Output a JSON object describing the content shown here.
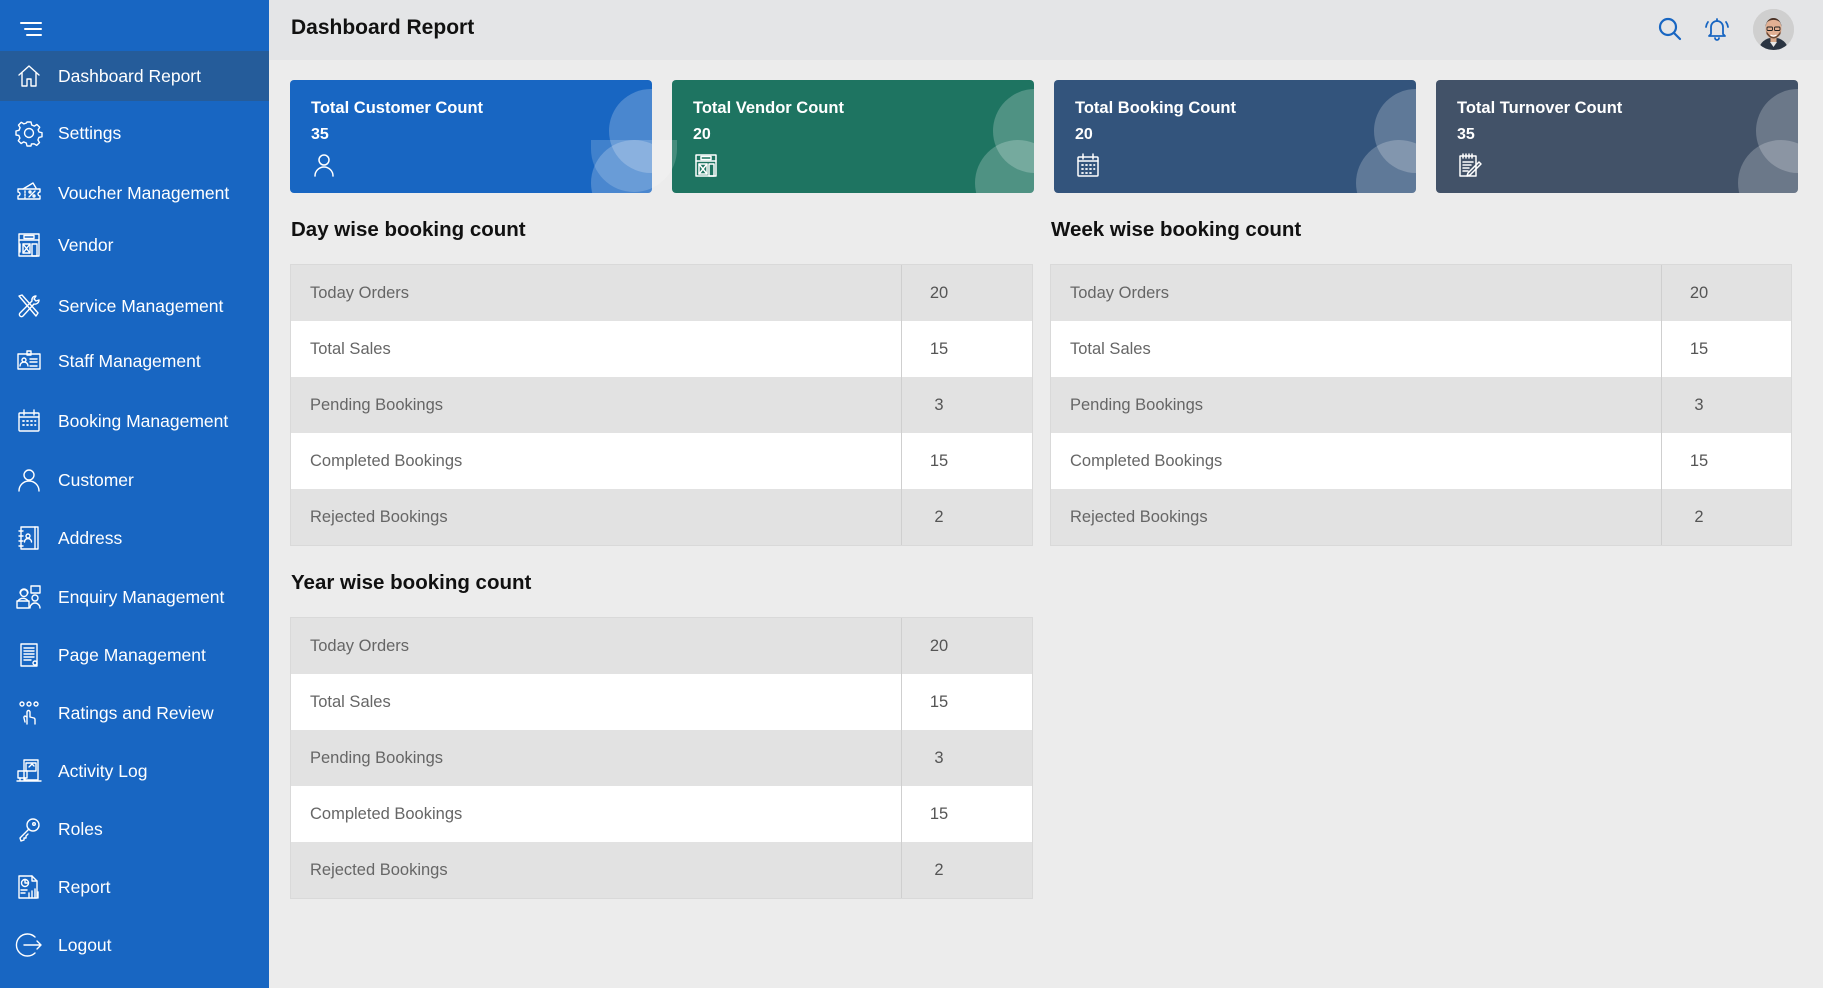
{
  "sidebar": {
    "items": [
      {
        "label": "Dashboard Report",
        "icon": "home-icon",
        "active": true
      },
      {
        "label": "Settings",
        "icon": "gear-icon"
      },
      {
        "label": "Voucher Management",
        "icon": "voucher-icon"
      },
      {
        "label": "Vendor",
        "icon": "storefront-icon"
      },
      {
        "label": "Service Management",
        "icon": "tools-icon"
      },
      {
        "label": "Staff Management",
        "icon": "id-card-icon"
      },
      {
        "label": "Booking Management",
        "icon": "calendar-icon"
      },
      {
        "label": "Customer",
        "icon": "user-icon"
      },
      {
        "label": "Address",
        "icon": "address-book-icon"
      },
      {
        "label": "Enquiry Management",
        "icon": "support-agent-icon"
      },
      {
        "label": "Page Management",
        "icon": "document-icon"
      },
      {
        "label": "Ratings and Review",
        "icon": "rating-hand-icon"
      },
      {
        "label": "Activity Log",
        "icon": "activity-log-icon"
      },
      {
        "label": "Roles",
        "icon": "key-icon"
      },
      {
        "label": "Report",
        "icon": "report-chart-icon"
      },
      {
        "label": "Logout",
        "icon": "logout-icon"
      }
    ]
  },
  "header": {
    "title": "Dashboard Report",
    "icons": [
      "search-icon",
      "bell-icon",
      "avatar"
    ]
  },
  "cards": [
    {
      "title": "Total Customer Count",
      "value": "35",
      "icon": "user-icon",
      "color": "#1866c2"
    },
    {
      "title": "Total Vendor Count",
      "value": "20",
      "icon": "storefront-icon",
      "color": "#1e7461"
    },
    {
      "title": "Total Booking Count",
      "value": "20",
      "icon": "calendar-icon",
      "color": "#33547c"
    },
    {
      "title": "Total Turnover Count",
      "value": "35",
      "icon": "notepad-edit-icon",
      "color": "#425268"
    }
  ],
  "sections": {
    "day": {
      "title": "Day wise booking count",
      "rows": [
        {
          "label": "Today Orders",
          "value": "20"
        },
        {
          "label": "Total Sales",
          "value": "15"
        },
        {
          "label": "Pending Bookings",
          "value": "3"
        },
        {
          "label": "Completed Bookings",
          "value": "15"
        },
        {
          "label": "Rejected Bookings",
          "value": "2"
        }
      ]
    },
    "week": {
      "title": "Week wise booking count",
      "rows": [
        {
          "label": "Today Orders",
          "value": "20"
        },
        {
          "label": "Total Sales",
          "value": "15"
        },
        {
          "label": "Pending Bookings",
          "value": "3"
        },
        {
          "label": "Completed Bookings",
          "value": "15"
        },
        {
          "label": "Rejected Bookings",
          "value": "2"
        }
      ]
    },
    "year": {
      "title": "Year wise booking count",
      "rows": [
        {
          "label": "Today Orders",
          "value": "20"
        },
        {
          "label": "Total Sales",
          "value": "15"
        },
        {
          "label": "Pending Bookings",
          "value": "3"
        },
        {
          "label": "Completed Bookings",
          "value": "15"
        },
        {
          "label": "Rejected Bookings",
          "value": "2"
        }
      ]
    }
  }
}
